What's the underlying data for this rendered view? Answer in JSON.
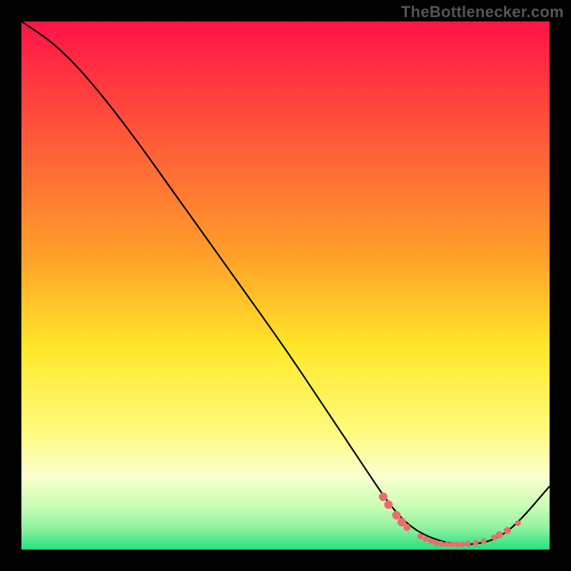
{
  "watermark": "TheBottlenecker.com",
  "chart_data": {
    "type": "line",
    "title": "",
    "xlabel": "",
    "ylabel": "",
    "xlim": [
      0,
      100
    ],
    "ylim": [
      0,
      100
    ],
    "gradient_stops": [
      {
        "offset": 0,
        "color": "#ff1347"
      },
      {
        "offset": 0.45,
        "color": "#ffa229"
      },
      {
        "offset": 0.62,
        "color": "#ffe82a"
      },
      {
        "offset": 0.78,
        "color": "#fffb7f"
      },
      {
        "offset": 0.86,
        "color": "#fbffd0"
      },
      {
        "offset": 0.92,
        "color": "#c7ffb3"
      },
      {
        "offset": 0.96,
        "color": "#8cf29e"
      },
      {
        "offset": 1.0,
        "color": "#22e07f"
      }
    ],
    "series": [
      {
        "name": "bottleneck-curve",
        "color": "#000000",
        "points": [
          {
            "x": 0,
            "y": 100
          },
          {
            "x": 6,
            "y": 96
          },
          {
            "x": 12,
            "y": 90
          },
          {
            "x": 20,
            "y": 80
          },
          {
            "x": 30,
            "y": 66
          },
          {
            "x": 40,
            "y": 52
          },
          {
            "x": 50,
            "y": 38
          },
          {
            "x": 58,
            "y": 26
          },
          {
            "x": 64,
            "y": 17
          },
          {
            "x": 70,
            "y": 8
          },
          {
            "x": 74,
            "y": 4
          },
          {
            "x": 78,
            "y": 2
          },
          {
            "x": 82,
            "y": 1
          },
          {
            "x": 86,
            "y": 1
          },
          {
            "x": 90,
            "y": 2
          },
          {
            "x": 94,
            "y": 5
          },
          {
            "x": 100,
            "y": 12
          }
        ]
      }
    ],
    "scatter": {
      "name": "data-points",
      "color": "#ee6b6e",
      "r_small": 4,
      "r_large": 6,
      "points": [
        {
          "x": 68.5,
          "y": 10,
          "r": 6
        },
        {
          "x": 69.5,
          "y": 8.5,
          "r": 6
        },
        {
          "x": 71,
          "y": 6.5,
          "r": 6
        },
        {
          "x": 72,
          "y": 5.2,
          "r": 6
        },
        {
          "x": 73,
          "y": 4.2,
          "r": 5
        },
        {
          "x": 75.5,
          "y": 2.5,
          "r": 4
        },
        {
          "x": 76.5,
          "y": 2,
          "r": 4
        },
        {
          "x": 77.5,
          "y": 1.6,
          "r": 4
        },
        {
          "x": 78.5,
          "y": 1.3,
          "r": 4
        },
        {
          "x": 79.5,
          "y": 1.1,
          "r": 4
        },
        {
          "x": 80.5,
          "y": 1,
          "r": 4
        },
        {
          "x": 81.5,
          "y": 1,
          "r": 4
        },
        {
          "x": 82.5,
          "y": 1,
          "r": 4
        },
        {
          "x": 83.5,
          "y": 1,
          "r": 4
        },
        {
          "x": 84.5,
          "y": 1.1,
          "r": 4
        },
        {
          "x": 86,
          "y": 1.3,
          "r": 4
        },
        {
          "x": 87.5,
          "y": 1.6,
          "r": 4
        },
        {
          "x": 89.5,
          "y": 2.3,
          "r": 4
        },
        {
          "x": 90.5,
          "y": 2.8,
          "r": 5
        },
        {
          "x": 92,
          "y": 3.6,
          "r": 5
        },
        {
          "x": 94,
          "y": 5,
          "r": 4
        }
      ]
    }
  }
}
